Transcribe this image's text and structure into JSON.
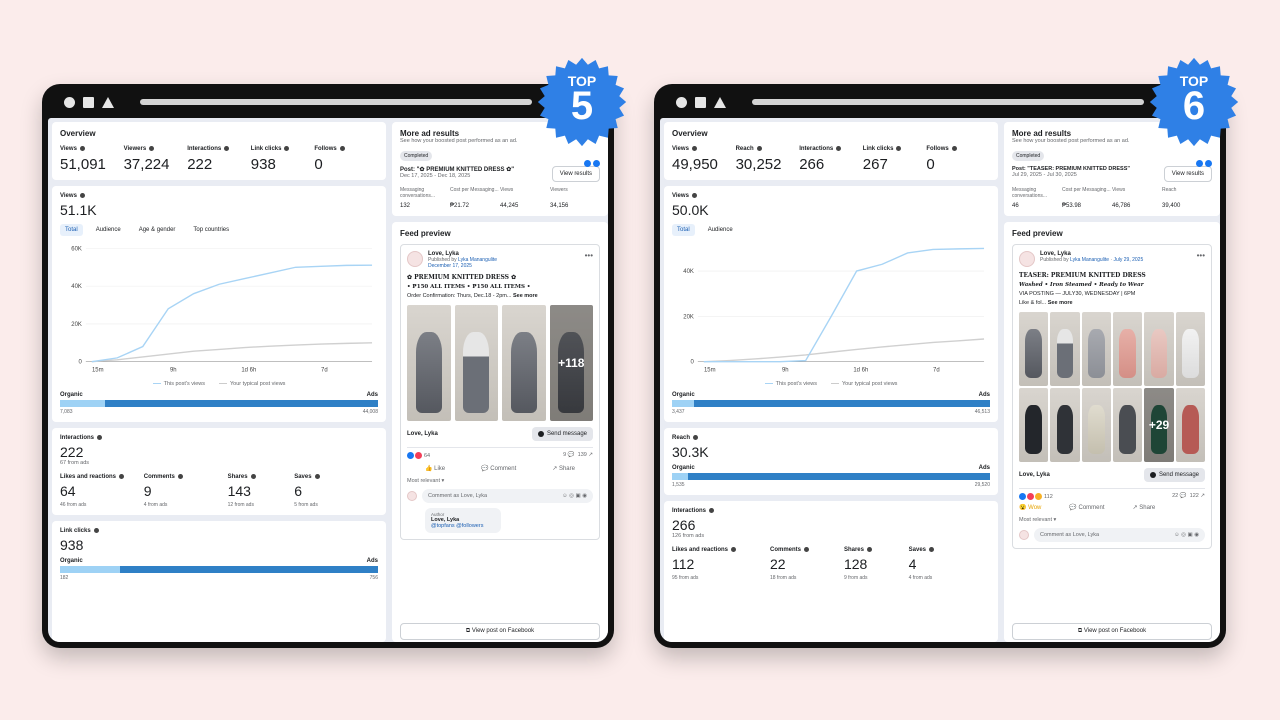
{
  "badges": [
    {
      "top": "TOP",
      "rank": "5",
      "color": "#2f80e6"
    },
    {
      "top": "TOP",
      "rank": "6",
      "color": "#2f80e6"
    }
  ],
  "w1": {
    "overview": {
      "title": "Overview",
      "metrics": [
        {
          "label": "Views",
          "value": "51,091"
        },
        {
          "label": "Viewers",
          "value": "37,224"
        },
        {
          "label": "Interactions",
          "value": "222"
        },
        {
          "label": "Link clicks",
          "value": "938"
        },
        {
          "label": "Follows",
          "value": "0"
        }
      ]
    },
    "views": {
      "label": "Views",
      "value": "51.1K",
      "tabs": [
        "Total",
        "Audience",
        "Age & gender",
        "Top countries"
      ],
      "organic_label": "Organic",
      "ads_label": "Ads",
      "organic_num": "7,083",
      "ads_num": "44,008",
      "organic_share": 0.14
    },
    "interactions": {
      "label": "Interactions",
      "value": "222",
      "sub": "67 from ads",
      "items": [
        {
          "label": "Likes and reactions",
          "value": "64",
          "sub": "46 from ads"
        },
        {
          "label": "Comments",
          "value": "9",
          "sub": "4 from ads"
        },
        {
          "label": "Shares",
          "value": "143",
          "sub": "12 from ads"
        },
        {
          "label": "Saves",
          "value": "6",
          "sub": "5 from ads"
        }
      ]
    },
    "linkclicks": {
      "label": "Link clicks",
      "value": "938",
      "organic_label": "Organic",
      "ads_label": "Ads",
      "organic_num": "182",
      "ads_num": "756",
      "organic_share": 0.19
    },
    "ad": {
      "title": "More ad results",
      "sub": "See how your boosted post performed as an ad.",
      "badge": "Completed",
      "post": "Post: \"✿ PREMIUM KNITTED DRESS ✿\"",
      "dates": "Dec 17, 2025 - Dec 18, 2025",
      "button": "View results",
      "cols": [
        {
          "k": "Messaging conversations...",
          "v": "132"
        },
        {
          "k": "Cost per Messaging...",
          "v": "₱21.72"
        },
        {
          "k": "Views",
          "v": "44,245"
        },
        {
          "k": "Viewers",
          "v": "34,156"
        }
      ]
    },
    "feed": {
      "title": "Feed preview",
      "page": "Love, Lyka",
      "published": "Published by",
      "publisher": "Lyka Manangulite",
      "date": "December 17, 2025",
      "headline": "✿ PREMIUM KNITTED DRESS ✿",
      "line1": "• ₱150 ALL ITEMS • ₱150 ALL ITEMS •",
      "line2": "Order Confirmation: Thurs, Dec.18 - 2pm...",
      "see_more": "See more",
      "plus": "+118",
      "footer_name": "Love, Lyka",
      "send": "Send message",
      "reactions": "64",
      "comments": "9",
      "shares": "139",
      "like": "Like",
      "comment": "Comment",
      "share": "Share",
      "most_relevant": "Most relevant ▾",
      "comment_placeholder": "Comment as Love, Lyka",
      "reply_author_tag": "Author",
      "reply_name": "Love, Lyka",
      "reply_text": "@topfans @followers",
      "view_fb": "View post on Facebook"
    },
    "chart_data": {
      "type": "line",
      "x_ticks": [
        "15m",
        "9h",
        "1d 6h",
        "7d"
      ],
      "y_ticks": [
        "0",
        "20K",
        "40K",
        "60K"
      ],
      "ylim": [
        0,
        60000
      ],
      "legend": [
        "This post's views",
        "Your typical post views"
      ],
      "series": [
        {
          "name": "This post's views",
          "color": "#a8d4f5",
          "values": [
            0,
            2000,
            8000,
            28000,
            36000,
            41000,
            44000,
            47000,
            50000,
            50500,
            51000,
            51091
          ]
        },
        {
          "name": "Your typical post views",
          "color": "#d0d0d0",
          "values": [
            0,
            1000,
            2500,
            4000,
            5500,
            6500,
            7500,
            8200,
            8800,
            9300,
            9700,
            10000
          ]
        }
      ]
    }
  },
  "w2": {
    "overview": {
      "title": "Overview",
      "metrics": [
        {
          "label": "Views",
          "value": "49,950"
        },
        {
          "label": "Reach",
          "value": "30,252"
        },
        {
          "label": "Interactions",
          "value": "266"
        },
        {
          "label": "Link clicks",
          "value": "267"
        },
        {
          "label": "Follows",
          "value": "0"
        }
      ]
    },
    "views": {
      "label": "Views",
      "value": "50.0K",
      "tabs": [
        "Total",
        "Audience"
      ],
      "organic_label": "Organic",
      "ads_label": "Ads",
      "organic_num": "3,437",
      "ads_num": "46,513",
      "organic_share": 0.07
    },
    "reach": {
      "label": "Reach",
      "value": "30.3K",
      "organic_label": "Organic",
      "ads_label": "Ads",
      "organic_num": "1,535",
      "ads_num": "29,520",
      "organic_share": 0.05
    },
    "interactions": {
      "label": "Interactions",
      "value": "266",
      "sub": "126 from ads",
      "items": [
        {
          "label": "Likes and reactions",
          "value": "112",
          "sub": "95 from ads"
        },
        {
          "label": "Comments",
          "value": "22",
          "sub": "18 from ads"
        },
        {
          "label": "Shares",
          "value": "128",
          "sub": "9 from ads"
        },
        {
          "label": "Saves",
          "value": "4",
          "sub": "4 from ads"
        }
      ]
    },
    "ad": {
      "title": "More ad results",
      "sub": "See how your boosted post performed as an ad.",
      "badge": "Completed",
      "post": "Post: \"TEASER: PREMIUM KNITTED DRESS\"",
      "dates": "Jul 29, 2025 - Jul 30, 2025",
      "button": "View results",
      "cols": [
        {
          "k": "Messaging conversations...",
          "v": "46"
        },
        {
          "k": "Cost per Messaging...",
          "v": "₱53.98"
        },
        {
          "k": "Views",
          "v": "46,786"
        },
        {
          "k": "Reach",
          "v": "39,400"
        }
      ]
    },
    "feed": {
      "title": "Feed preview",
      "page": "Love, Lyka",
      "published": "Published by",
      "publisher": "Lyka Manangulite",
      "date": "July 29, 2025",
      "headline": "TEASER: PREMIUM KNITTED DRESS",
      "line1": "Washed • Iron Steamed • Ready to Wear",
      "line2": "VIA POSTING — JULY30, WEDNESDAY | 6PM",
      "line3": "Like & fol...",
      "see_more": "See more",
      "plus": "+29",
      "footer_name": "Love, Lyka",
      "send": "Send message",
      "reactions": "112",
      "comments": "22",
      "shares": "122",
      "wow": "Wow",
      "comment": "Comment",
      "share": "Share",
      "most_relevant": "Most relevant ▾",
      "comment_placeholder": "Comment as Love, Lyka",
      "view_fb": "View post on Facebook"
    },
    "chart_data": {
      "type": "line",
      "x_ticks": [
        "15m",
        "9h",
        "1d 6h",
        "7d"
      ],
      "y_ticks": [
        "0",
        "20K",
        "40K"
      ],
      "ylim": [
        0,
        50000
      ],
      "legend": [
        "This post's views",
        "Your typical post views"
      ],
      "series": [
        {
          "name": "This post's views",
          "color": "#a8d4f5",
          "values": [
            0,
            0,
            0,
            0,
            500,
            20000,
            40000,
            43000,
            48000,
            49500,
            49800,
            49950
          ]
        },
        {
          "name": "Your typical post views",
          "color": "#d0d0d0",
          "values": [
            0,
            500,
            1200,
            2000,
            3000,
            4200,
            5400,
            6500,
            7500,
            8500,
            9200,
            10000
          ]
        }
      ]
    }
  }
}
